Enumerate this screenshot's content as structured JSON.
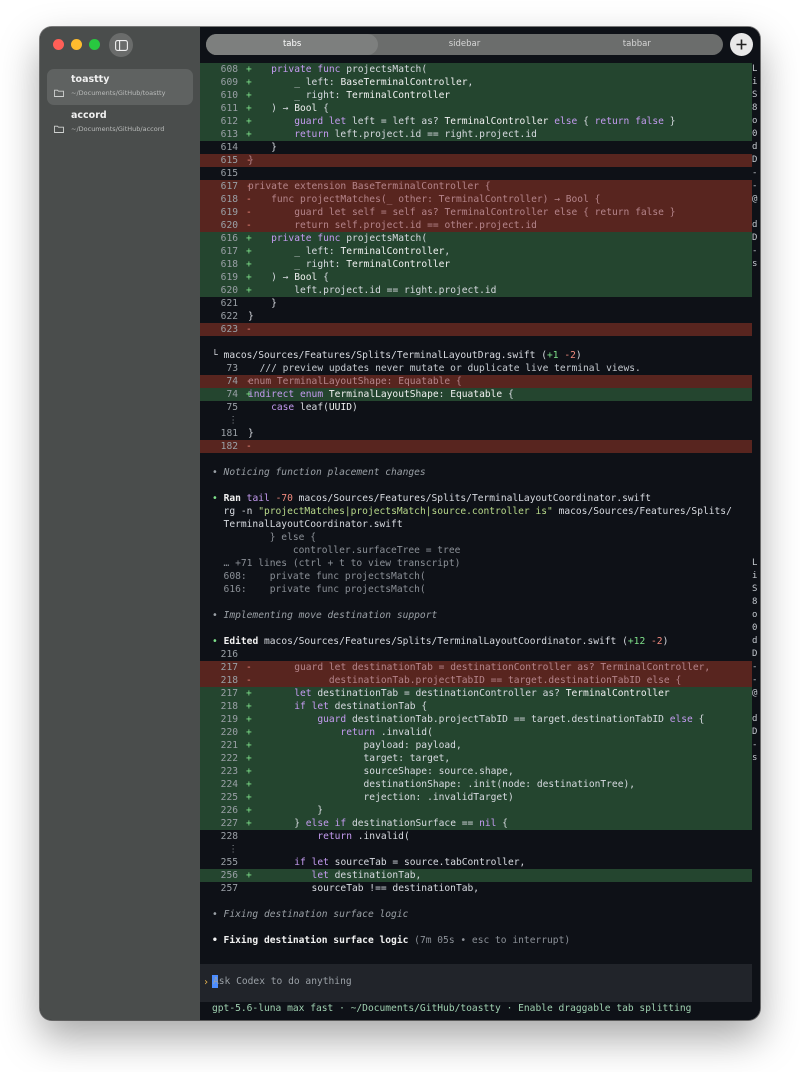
{
  "window": {
    "traffic_lights": [
      "close",
      "minimize",
      "zoom"
    ]
  },
  "sidebar": {
    "toggle_icon": "sidebar-icon",
    "projects": [
      {
        "name": "toastty",
        "path": "~/Documents/GitHub/toastty",
        "active": true
      },
      {
        "name": "accord",
        "path": "~/Documents/GitHub/accord",
        "active": false
      }
    ]
  },
  "tabbar": {
    "tabs": [
      "tabs",
      "sidebar",
      "tabbar"
    ],
    "active_tab": "tabs",
    "new_tab_icon": "plus-icon"
  },
  "terminal": {
    "lines": [
      {
        "kind": "add",
        "num": "608",
        "sign": "+",
        "text": "    private func projectsMatch("
      },
      {
        "kind": "add",
        "num": "609",
        "sign": "+",
        "text": "        _ left: BaseTerminalController,"
      },
      {
        "kind": "add",
        "num": "610",
        "sign": "+",
        "text": "        _ right: TerminalController"
      },
      {
        "kind": "add",
        "num": "611",
        "sign": "+",
        "text": "    ) → Bool {"
      },
      {
        "kind": "add",
        "num": "612",
        "sign": "+",
        "text": "        guard let left = left as? TerminalController else { return false }"
      },
      {
        "kind": "add",
        "num": "613",
        "sign": "+",
        "text": "        return left.project.id == right.project.id"
      },
      {
        "kind": "ctx",
        "num": "614",
        "sign": "",
        "text": "    }"
      },
      {
        "kind": "del",
        "num": "615",
        "sign": "-",
        "text": "}"
      },
      {
        "kind": "ctx",
        "num": "615",
        "sign": "",
        "text": ""
      },
      {
        "kind": "del",
        "num": "617",
        "sign": "-",
        "text": "private extension BaseTerminalController {"
      },
      {
        "kind": "del",
        "num": "618",
        "sign": "-",
        "text": "    func projectMatches(_ other: TerminalController) → Bool {"
      },
      {
        "kind": "del",
        "num": "619",
        "sign": "-",
        "text": "        guard let self = self as? TerminalController else { return false }"
      },
      {
        "kind": "del",
        "num": "620",
        "sign": "-",
        "text": "        return self.project.id == other.project.id"
      },
      {
        "kind": "add",
        "num": "616",
        "sign": "+",
        "text": "    private func projectsMatch("
      },
      {
        "kind": "add",
        "num": "617",
        "sign": "+",
        "text": "        _ left: TerminalController,"
      },
      {
        "kind": "add",
        "num": "618",
        "sign": "+",
        "text": "        _ right: TerminalController"
      },
      {
        "kind": "add",
        "num": "619",
        "sign": "+",
        "text": "    ) → Bool {"
      },
      {
        "kind": "add",
        "num": "620",
        "sign": "+",
        "text": "        left.project.id == right.project.id"
      },
      {
        "kind": "ctx",
        "num": "621",
        "sign": "",
        "text": "    }"
      },
      {
        "kind": "ctx",
        "num": "622",
        "sign": "",
        "text": "}"
      },
      {
        "kind": "del",
        "num": "623",
        "sign": "-",
        "text": ""
      },
      {
        "kind": "blank"
      },
      {
        "kind": "file",
        "text": "└ macos/Sources/Features/Splits/TerminalLayoutDrag.swift",
        "plus": "+1",
        "minus": "-2"
      },
      {
        "kind": "ctx",
        "num": "73",
        "sign": "",
        "text": "  /// preview updates never mutate or duplicate live terminal views."
      },
      {
        "kind": "del",
        "num": "74",
        "sign": "-",
        "text": "enum TerminalLayoutShape: Equatable {"
      },
      {
        "kind": "add",
        "num": "74",
        "sign": "+",
        "text": "indirect enum TerminalLayoutShape: Equatable {"
      },
      {
        "kind": "ctx",
        "num": "75",
        "sign": "",
        "text": "    case leaf(UUID)"
      },
      {
        "kind": "ellipsis"
      },
      {
        "kind": "ctx",
        "num": "181",
        "sign": "",
        "text": "}"
      },
      {
        "kind": "del",
        "num": "182",
        "sign": "-",
        "text": ""
      },
      {
        "kind": "blank"
      },
      {
        "kind": "note",
        "text": "• Noticing function placement changes"
      },
      {
        "kind": "blank"
      },
      {
        "kind": "ran",
        "cmd": "tail -70 macos/Sources/Features/Splits/TerminalLayoutCoordinator.swift"
      },
      {
        "kind": "rg",
        "text": "rg -n \"projectMatches|projectsMatch|source.controller is\" macos/Sources/Features/Splits/"
      },
      {
        "kind": "plain",
        "text": "  TerminalLayoutCoordinator.swift"
      },
      {
        "kind": "plain",
        "dim": true,
        "text": "          } else {"
      },
      {
        "kind": "plain",
        "dim": true,
        "text": "              controller.surfaceTree = tree"
      },
      {
        "kind": "plain",
        "dim": true,
        "text": "  … +71 lines (ctrl + t to view transcript)"
      },
      {
        "kind": "plain",
        "dim": true,
        "text": "  608:    private func projectsMatch("
      },
      {
        "kind": "plain",
        "dim": true,
        "text": "  616:    private func projectsMatch("
      },
      {
        "kind": "blank"
      },
      {
        "kind": "note",
        "text": "• Implementing move destination support"
      },
      {
        "kind": "blank"
      },
      {
        "kind": "edited",
        "label": "Edited",
        "file": "macos/Sources/Features/Splits/TerminalLayoutCoordinator.swift",
        "plus": "+12",
        "minus": "-2"
      },
      {
        "kind": "ctx",
        "num": "216",
        "sign": "",
        "text": ""
      },
      {
        "kind": "del",
        "num": "217",
        "sign": "-",
        "text": "        guard let destinationTab = destinationController as? TerminalController,"
      },
      {
        "kind": "del",
        "num": "218",
        "sign": "-",
        "text": "              destinationTab.projectTabID == target.destinationTabID else {"
      },
      {
        "kind": "add",
        "num": "217",
        "sign": "+",
        "text": "        let destinationTab = destinationController as? TerminalController"
      },
      {
        "kind": "add",
        "num": "218",
        "sign": "+",
        "text": "        if let destinationTab {"
      },
      {
        "kind": "add",
        "num": "219",
        "sign": "+",
        "text": "            guard destinationTab.projectTabID == target.destinationTabID else {"
      },
      {
        "kind": "add",
        "num": "220",
        "sign": "+",
        "text": "                return .invalid("
      },
      {
        "kind": "add",
        "num": "221",
        "sign": "+",
        "text": "                    payload: payload,"
      },
      {
        "kind": "add",
        "num": "222",
        "sign": "+",
        "text": "                    target: target,"
      },
      {
        "kind": "add",
        "num": "223",
        "sign": "+",
        "text": "                    sourceShape: source.shape,"
      },
      {
        "kind": "add",
        "num": "224",
        "sign": "+",
        "text": "                    destinationShape: .init(node: destinationTree),"
      },
      {
        "kind": "add",
        "num": "225",
        "sign": "+",
        "text": "                    rejection: .invalidTarget)"
      },
      {
        "kind": "add",
        "num": "226",
        "sign": "+",
        "text": "            }"
      },
      {
        "kind": "add",
        "num": "227",
        "sign": "+",
        "text": "        } else if destinationSurface == nil {"
      },
      {
        "kind": "ctx",
        "num": "228",
        "sign": "",
        "text": "            return .invalid("
      },
      {
        "kind": "ellipsis"
      },
      {
        "kind": "ctx",
        "num": "255",
        "sign": "",
        "text": "        if let sourceTab = source.tabController,"
      },
      {
        "kind": "add",
        "num": "256",
        "sign": "+",
        "text": "           let destinationTab,"
      },
      {
        "kind": "ctx",
        "num": "257",
        "sign": "",
        "text": "           sourceTab !== destinationTab,"
      },
      {
        "kind": "blank"
      },
      {
        "kind": "note",
        "text": "• Fixing destination surface logic"
      },
      {
        "kind": "blank"
      },
      {
        "kind": "working",
        "title": "• Fixing destination surface logic",
        "meta": "(7m 05s • esc to interrupt)"
      }
    ],
    "rail": [
      "L",
      "i",
      "S",
      "8",
      "o",
      "0",
      "d",
      "D",
      "-",
      "-",
      "@",
      "",
      "d",
      "D",
      "-",
      "s",
      "",
      "",
      "",
      "",
      "",
      "",
      "",
      "",
      "",
      "",
      "",
      "",
      "",
      "",
      "",
      "",
      "",
      "",
      "",
      "",
      "",
      "",
      "L",
      "i",
      "S",
      "8",
      "o",
      "0",
      "d",
      "D",
      "-",
      "-",
      "@",
      "",
      "d",
      "D",
      "-",
      "s"
    ]
  },
  "prompt": {
    "caret": "›",
    "placeholder": "Ask Codex to do anything"
  },
  "status": {
    "text": "gpt-5.6-luna max fast · ~/Documents/GitHub/toastty · Enable draggable tab splitting"
  }
}
